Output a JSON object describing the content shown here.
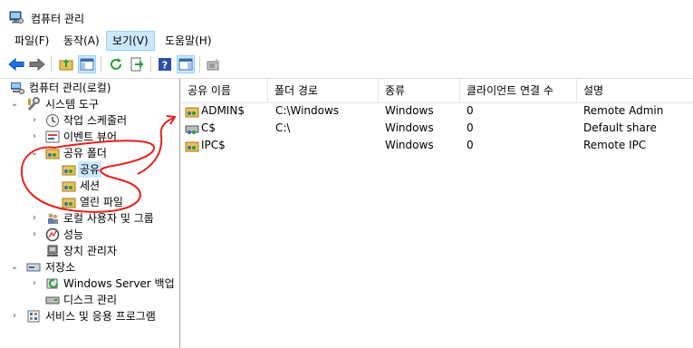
{
  "window": {
    "title": "컴퓨터 관리"
  },
  "menu": [
    {
      "label": "파일(F)"
    },
    {
      "label": "동작(A)"
    },
    {
      "label": "보기(V)"
    },
    {
      "label": "도움말(H)"
    }
  ],
  "toolbar": {
    "buttons": [
      "back-icon",
      "forward-icon",
      "up-folder-icon",
      "show-hide-tree-icon",
      "refresh-icon",
      "export-list-icon",
      "help-icon",
      "action-pane-icon",
      "new-share-icon"
    ]
  },
  "tree": {
    "nodes": [
      {
        "label": "컴퓨터 관리(로컬)",
        "icon": "computer-management-icon"
      },
      {
        "label": "시스템 도구",
        "icon": "tools-icon",
        "expanded": true
      },
      {
        "label": "작업 스케줄러",
        "icon": "clock-icon"
      },
      {
        "label": "이벤트 뷰어",
        "icon": "event-viewer-icon"
      },
      {
        "label": "공유 폴더",
        "icon": "shared-folder-icon",
        "expanded": true
      },
      {
        "label": "공유",
        "icon": "shares-icon",
        "selected": true
      },
      {
        "label": "세션",
        "icon": "sessions-icon"
      },
      {
        "label": "열린 파일",
        "icon": "open-files-icon"
      },
      {
        "label": "로컬 사용자 및 그룹",
        "icon": "users-icon"
      },
      {
        "label": "성능",
        "icon": "performance-icon"
      },
      {
        "label": "장치 관리자",
        "icon": "device-manager-icon"
      },
      {
        "label": "저장소",
        "icon": "storage-icon",
        "expanded": true
      },
      {
        "label": "Windows Server 백업",
        "icon": "backup-icon"
      },
      {
        "label": "디스크 관리",
        "icon": "disk-icon"
      },
      {
        "label": "서비스 및 응용 프로그램",
        "icon": "services-icon"
      }
    ]
  },
  "shares": {
    "columns": [
      "공유 이름",
      "폴더 경로",
      "종류",
      "클라이언트 연결 수",
      "설명"
    ],
    "rows": [
      {
        "name": "ADMIN$",
        "path": "C:\\Windows",
        "type": "Windows",
        "connections": "0",
        "description": "Remote Admin"
      },
      {
        "name": "C$",
        "path": "C:\\",
        "type": "Windows",
        "connections": "0",
        "description": "Default share"
      },
      {
        "name": "IPC$",
        "path": "",
        "type": "Windows",
        "connections": "0",
        "description": "Remote IPC"
      }
    ]
  },
  "colors": {
    "selection": "#cce8ff",
    "annotation": "#e8201c"
  }
}
